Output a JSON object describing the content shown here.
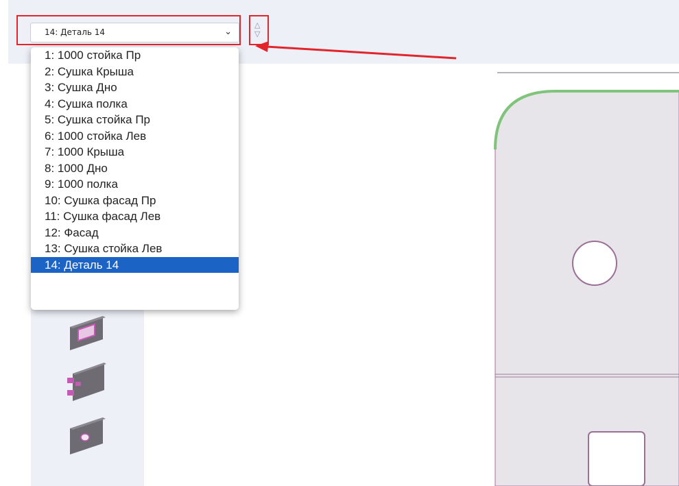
{
  "part_select": {
    "current_value": "14: Деталь 14",
    "options": [
      "1: 1000 стойка Пр",
      "2: Сушка Крыша",
      "3: Сушка Дно",
      "4: Сушка полка",
      "5: Сушка стойка Пр",
      "6: 1000 стойка Лев",
      "7: 1000 Крыша",
      "8: 1000 Дно",
      "9: 1000 полка",
      "10: Сушка фасад Пр",
      "11: Сушка фасад Лев",
      "12: Фасад",
      "13: Сушка стойка Лев",
      "14: Деталь 14"
    ],
    "selected_index": 13,
    "arrow_icon": "chevron-down-icon"
  },
  "stepper": {
    "up_icon": "triangle-up-outline-icon",
    "down_icon": "triangle-down-outline-icon"
  },
  "annotations": {
    "highlight_color": "#e2242b",
    "arrow_color": "#e2242b"
  },
  "colors": {
    "selection_bg": "#1b63c5",
    "panel_bg": "#eef0f8",
    "edge_band": "#7fc47a",
    "part_outline": "#b06aa0",
    "part_fill": "#e6e3e8"
  }
}
